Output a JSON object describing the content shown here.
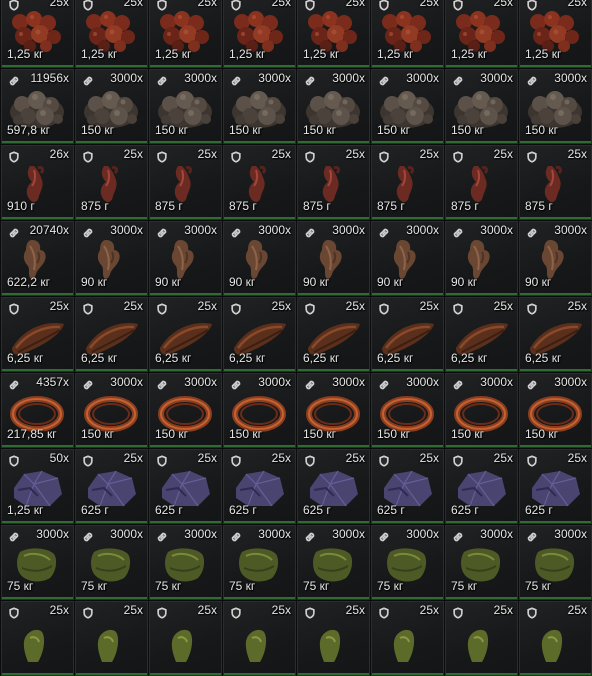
{
  "inventory": {
    "rows": [
      {
        "item": "raw-meat-chunks",
        "cells": [
          {
            "icon": "shield-icon",
            "qty": "25x",
            "weight": "1,25 кг"
          },
          {
            "icon": "shield-icon",
            "qty": "25x",
            "weight": "1,25 кг"
          },
          {
            "icon": "shield-icon",
            "qty": "25x",
            "weight": "1,25 кг"
          },
          {
            "icon": "shield-icon",
            "qty": "25x",
            "weight": "1,25 кг"
          },
          {
            "icon": "shield-icon",
            "qty": "25x",
            "weight": "1,25 кг"
          },
          {
            "icon": "shield-icon",
            "qty": "25x",
            "weight": "1,25 кг"
          },
          {
            "icon": "shield-icon",
            "qty": "25x",
            "weight": "1,25 кг"
          },
          {
            "icon": "shield-icon",
            "qty": "25x",
            "weight": "1,25 кг"
          }
        ]
      },
      {
        "item": "rock-ore-pile",
        "cells": [
          {
            "icon": "link-icon",
            "qty": "11956x",
            "weight": "597,8 кг"
          },
          {
            "icon": "link-icon",
            "qty": "3000x",
            "weight": "150 кг"
          },
          {
            "icon": "link-icon",
            "qty": "3000x",
            "weight": "150 кг"
          },
          {
            "icon": "link-icon",
            "qty": "3000x",
            "weight": "150 кг"
          },
          {
            "icon": "link-icon",
            "qty": "3000x",
            "weight": "150 кг"
          },
          {
            "icon": "link-icon",
            "qty": "3000x",
            "weight": "150 кг"
          },
          {
            "icon": "link-icon",
            "qty": "3000x",
            "weight": "150 кг"
          },
          {
            "icon": "link-icon",
            "qty": "3000x",
            "weight": "150 кг"
          }
        ]
      },
      {
        "item": "animal-heart",
        "cells": [
          {
            "icon": "shield-icon",
            "qty": "26x",
            "weight": "910 г"
          },
          {
            "icon": "shield-icon",
            "qty": "25x",
            "weight": "875 г"
          },
          {
            "icon": "shield-icon",
            "qty": "25x",
            "weight": "875 г"
          },
          {
            "icon": "shield-icon",
            "qty": "25x",
            "weight": "875 г"
          },
          {
            "icon": "shield-icon",
            "qty": "25x",
            "weight": "875 г"
          },
          {
            "icon": "shield-icon",
            "qty": "25x",
            "weight": "875 г"
          },
          {
            "icon": "shield-icon",
            "qty": "25x",
            "weight": "875 г"
          },
          {
            "icon": "shield-icon",
            "qty": "25x",
            "weight": "875 г"
          }
        ]
      },
      {
        "item": "hide-pelt",
        "cells": [
          {
            "icon": "link-icon",
            "qty": "20740x",
            "weight": "622,2 кг"
          },
          {
            "icon": "link-icon",
            "qty": "3000x",
            "weight": "90 кг"
          },
          {
            "icon": "link-icon",
            "qty": "3000x",
            "weight": "90 кг"
          },
          {
            "icon": "link-icon",
            "qty": "3000x",
            "weight": "90 кг"
          },
          {
            "icon": "link-icon",
            "qty": "3000x",
            "weight": "90 кг"
          },
          {
            "icon": "link-icon",
            "qty": "3000x",
            "weight": "90 кг"
          },
          {
            "icon": "link-icon",
            "qty": "3000x",
            "weight": "90 кг"
          },
          {
            "icon": "link-icon",
            "qty": "3000x",
            "weight": "90 кг"
          }
        ]
      },
      {
        "item": "leather-strip",
        "cells": [
          {
            "icon": "shield-icon",
            "qty": "25x",
            "weight": "6,25 кг"
          },
          {
            "icon": "shield-icon",
            "qty": "25x",
            "weight": "6,25 кг"
          },
          {
            "icon": "shield-icon",
            "qty": "25x",
            "weight": "6,25 кг"
          },
          {
            "icon": "shield-icon",
            "qty": "25x",
            "weight": "6,25 кг"
          },
          {
            "icon": "shield-icon",
            "qty": "25x",
            "weight": "6,25 кг"
          },
          {
            "icon": "shield-icon",
            "qty": "25x",
            "weight": "6,25 кг"
          },
          {
            "icon": "shield-icon",
            "qty": "25x",
            "weight": "6,25 кг"
          },
          {
            "icon": "shield-icon",
            "qty": "25x",
            "weight": "6,25 кг"
          }
        ]
      },
      {
        "item": "rope-coil",
        "cells": [
          {
            "icon": "link-icon",
            "qty": "4357x",
            "weight": "217,85 кг"
          },
          {
            "icon": "link-icon",
            "qty": "3000x",
            "weight": "150 кг"
          },
          {
            "icon": "link-icon",
            "qty": "3000x",
            "weight": "150 кг"
          },
          {
            "icon": "link-icon",
            "qty": "3000x",
            "weight": "150 кг"
          },
          {
            "icon": "link-icon",
            "qty": "3000x",
            "weight": "150 кг"
          },
          {
            "icon": "link-icon",
            "qty": "3000x",
            "weight": "150 кг"
          },
          {
            "icon": "link-icon",
            "qty": "3000x",
            "weight": "150 кг"
          },
          {
            "icon": "link-icon",
            "qty": "3000x",
            "weight": "150 кг"
          }
        ]
      },
      {
        "item": "purple-ore-stone",
        "cells": [
          {
            "icon": "shield-icon",
            "qty": "50x",
            "weight": "1,25 кг"
          },
          {
            "icon": "shield-icon",
            "qty": "25x",
            "weight": "625 г"
          },
          {
            "icon": "shield-icon",
            "qty": "25x",
            "weight": "625 г"
          },
          {
            "icon": "shield-icon",
            "qty": "25x",
            "weight": "625 г"
          },
          {
            "icon": "shield-icon",
            "qty": "25x",
            "weight": "625 г"
          },
          {
            "icon": "shield-icon",
            "qty": "25x",
            "weight": "625 г"
          },
          {
            "icon": "shield-icon",
            "qty": "25x",
            "weight": "625 г"
          },
          {
            "icon": "shield-icon",
            "qty": "25x",
            "weight": "625 г"
          }
        ]
      },
      {
        "item": "green-fiber-bundle",
        "cells": [
          {
            "icon": "link-icon",
            "qty": "3000x",
            "weight": "75 кг"
          },
          {
            "icon": "link-icon",
            "qty": "3000x",
            "weight": "75 кг"
          },
          {
            "icon": "link-icon",
            "qty": "3000x",
            "weight": "75 кг"
          },
          {
            "icon": "link-icon",
            "qty": "3000x",
            "weight": "75 кг"
          },
          {
            "icon": "link-icon",
            "qty": "3000x",
            "weight": "75 кг"
          },
          {
            "icon": "link-icon",
            "qty": "3000x",
            "weight": "75 кг"
          },
          {
            "icon": "link-icon",
            "qty": "3000x",
            "weight": "75 кг"
          },
          {
            "icon": "link-icon",
            "qty": "3000x",
            "weight": "75 кг"
          }
        ]
      },
      {
        "item": "green-herb",
        "cells": [
          {
            "icon": "shield-icon",
            "qty": "25x",
            "weight": ""
          },
          {
            "icon": "shield-icon",
            "qty": "25x",
            "weight": ""
          },
          {
            "icon": "shield-icon",
            "qty": "25x",
            "weight": ""
          },
          {
            "icon": "shield-icon",
            "qty": "25x",
            "weight": ""
          },
          {
            "icon": "shield-icon",
            "qty": "25x",
            "weight": ""
          },
          {
            "icon": "shield-icon",
            "qty": "25x",
            "weight": ""
          },
          {
            "icon": "shield-icon",
            "qty": "25x",
            "weight": ""
          },
          {
            "icon": "shield-icon",
            "qty": "25x",
            "weight": ""
          }
        ]
      }
    ]
  },
  "colors": {
    "slot_bar": "#2f6b32",
    "text": "#e6e6e6"
  }
}
